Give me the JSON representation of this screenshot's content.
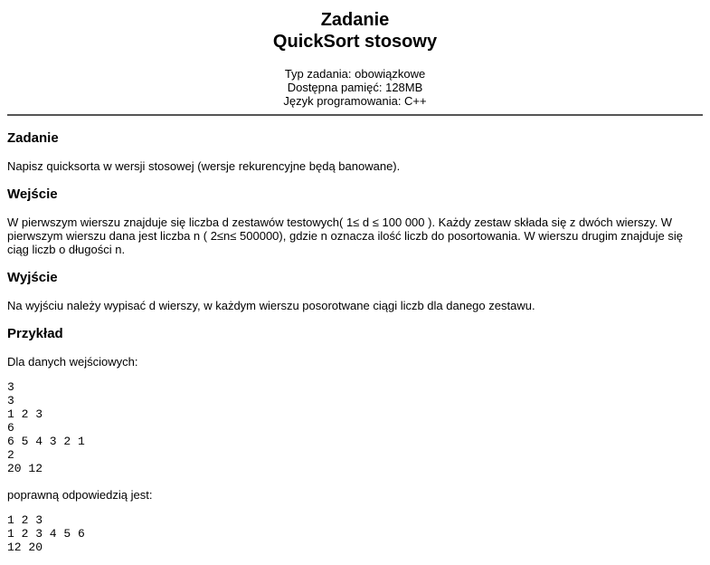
{
  "title": {
    "line1": "Zadanie",
    "line2": "QuickSort stosowy"
  },
  "meta": {
    "type": "Typ zadania: obowiązkowe",
    "memory": "Dostępna pamięć: 128MB",
    "language": "Język programowania: C++"
  },
  "sections": {
    "task": {
      "heading": "Zadanie",
      "text": "Napisz quicksorta w wersji stosowej (wersje rekurencyjne będą banowane)."
    },
    "input": {
      "heading": "Wejście",
      "text": "W pierwszym wierszu znajduje się liczba d zestawów testowych( 1≤ d ≤ 100 000 ). Każdy zestaw składa się z dwóch wierszy. W pierwszym wierszu dana jest liczba n ( 2≤n≤ 500000), gdzie n oznacza ilość liczb do posortowania. W wierszu drugim znajduje się ciąg liczb o długości n."
    },
    "output": {
      "heading": "Wyjście",
      "text": "Na wyjściu należy wypisać d wierszy, w każdym wierszu posorotwane ciągi liczb dla danego zestawu."
    },
    "example": {
      "heading": "Przykład",
      "input_intro": "Dla danych wejściowych:",
      "input_data": "3\n3\n1 2 3\n6\n6 5 4 3 2 1\n2\n20 12",
      "output_intro": "poprawną odpowiedzią jest:",
      "output_data": "1 2 3\n1 2 3 4 5 6\n12 20"
    }
  }
}
